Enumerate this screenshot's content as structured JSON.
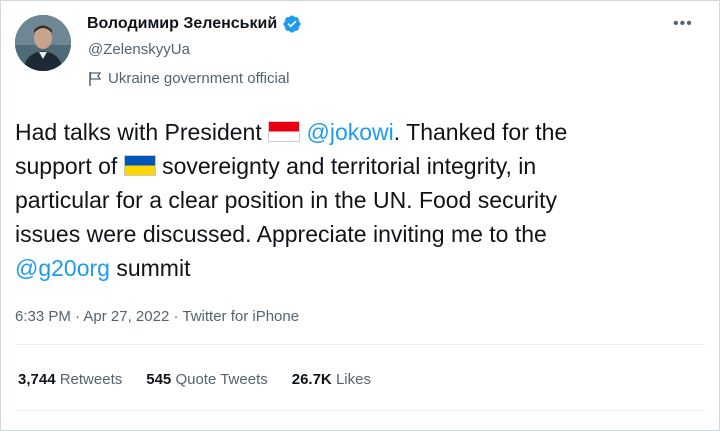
{
  "author": {
    "name": "Володимир Зеленський",
    "handle": "@ZelenskyyUa",
    "label": "Ukraine government official"
  },
  "tweet": {
    "line1_a": "Had talks with President ",
    "mention_jokowi": "@jokowi",
    "line1_b": ". Thanked for the",
    "line2_a": "support of ",
    "line2_b": " sovereignty and territorial integrity, in",
    "line3": "particular for a clear position in the UN. Food security",
    "line4": "issues were discussed. Appreciate inviting me to the",
    "mention_g20": "@g20org",
    "line5_b": " summit"
  },
  "meta": {
    "time": "6:33 PM",
    "sep1": " · ",
    "date": "Apr 27, 2022",
    "sep2": " · ",
    "source": "Twitter for iPhone"
  },
  "stats": {
    "retweets_count": "3,744",
    "retweets_label": "Retweets",
    "quotes_count": "545",
    "quotes_label": "Quote Tweets",
    "likes_count": "26.7K",
    "likes_label": "Likes"
  },
  "icons": {
    "more": "more-options-icon",
    "verified": "verified-badge-icon",
    "label": "government-flag-icon",
    "flag_indonesia": "indonesia-flag-icon",
    "flag_ukraine": "ukraine-flag-icon"
  },
  "colors": {
    "accent": "#1d9bf0",
    "secondary_text": "#536471",
    "primary_text": "#0f1419"
  }
}
